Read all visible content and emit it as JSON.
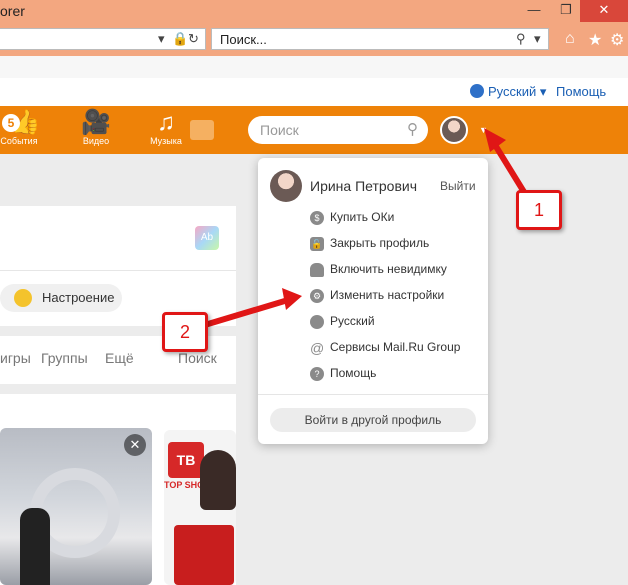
{
  "browser": {
    "title_fragment": "orer",
    "search_text": "Поиск...",
    "close_glyph": "✕",
    "restore_glyph": "❐",
    "minimize_glyph": "—"
  },
  "langbar": {
    "language": "Русский ▾",
    "help": "Помощь"
  },
  "nav": {
    "badge": "5",
    "events": "События",
    "video": "Видео",
    "music": "Музыка",
    "search_placeholder": "Поиск"
  },
  "page": {
    "mood": "Настроение",
    "ab_badge": "Ab",
    "tabs": [
      "игры",
      "Группы",
      "Ещё",
      "Поиск"
    ],
    "tv": "ТВ",
    "top_shop": "TOP SHOP"
  },
  "menu": {
    "user_name": "Ирина Петрович",
    "logout": "Выйти",
    "items": [
      {
        "label": "Купить ОКи",
        "icon": "coin-icon"
      },
      {
        "label": "Закрыть профиль",
        "icon": "lock-icon"
      },
      {
        "label": "Включить невидимку",
        "icon": "hat-icon"
      },
      {
        "label": "Изменить настройки",
        "icon": "gear-icon"
      },
      {
        "label": "Русский",
        "icon": "globe-icon"
      },
      {
        "label": "Сервисы Mail.Ru Group",
        "icon": "at-icon"
      },
      {
        "label": "Помощь",
        "icon": "question-icon"
      }
    ],
    "switch_profile": "Войти в другой профиль"
  },
  "annotations": {
    "callout_1": "1",
    "callout_2": "2",
    "color": "#e01616"
  },
  "colors": {
    "ok_orange": "#ee8208",
    "browser_chrome": "#f3a780"
  }
}
